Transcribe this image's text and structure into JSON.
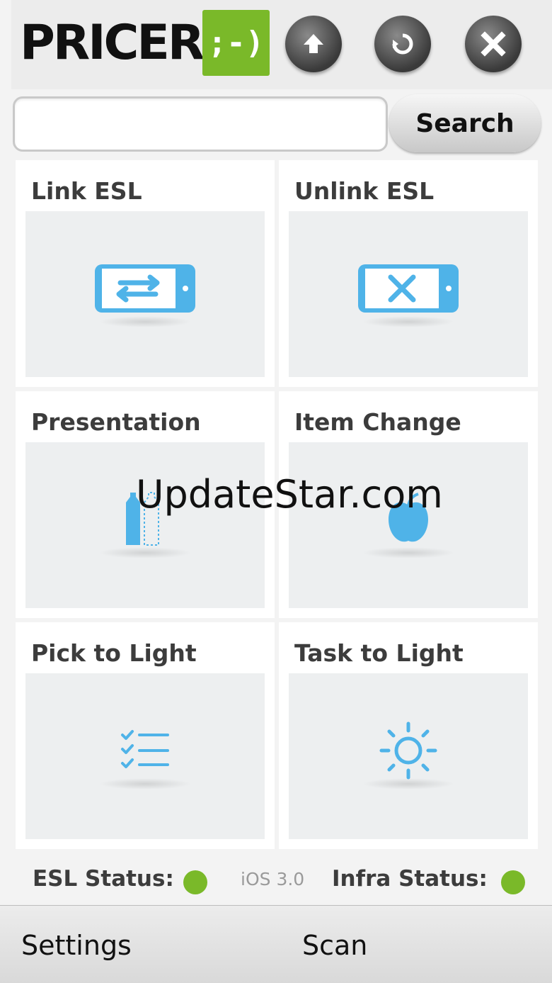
{
  "header": {
    "logo_text": "PRICER",
    "logo_mark": ";-)",
    "buttons": [
      {
        "name": "upload",
        "icon": "arrow-up-icon"
      },
      {
        "name": "refresh",
        "icon": "refresh-icon"
      },
      {
        "name": "close",
        "icon": "close-icon"
      }
    ]
  },
  "search": {
    "value": "",
    "button_label": "Search"
  },
  "tiles": [
    {
      "label": "Link ESL",
      "icon": "link-esl-icon"
    },
    {
      "label": "Unlink ESL",
      "icon": "unlink-esl-icon"
    },
    {
      "label": "Presentation",
      "icon": "bottle-icon"
    },
    {
      "label": "Item Change",
      "icon": "apple-icon"
    },
    {
      "label": "Pick to Light",
      "icon": "checklist-icon"
    },
    {
      "label": "Task to Light",
      "icon": "sun-icon"
    }
  ],
  "status": {
    "esl_label": "ESL Status:",
    "esl_color": "#7ab929",
    "version": "iOS 3.0",
    "infra_label": "Infra Status:",
    "infra_color": "#7ab929"
  },
  "bottom_nav": {
    "settings": "Settings",
    "scan": "Scan"
  },
  "watermark": "UpdateStar.com",
  "colors": {
    "brand_green": "#7ab929",
    "icon_blue": "#4fb3e8"
  }
}
